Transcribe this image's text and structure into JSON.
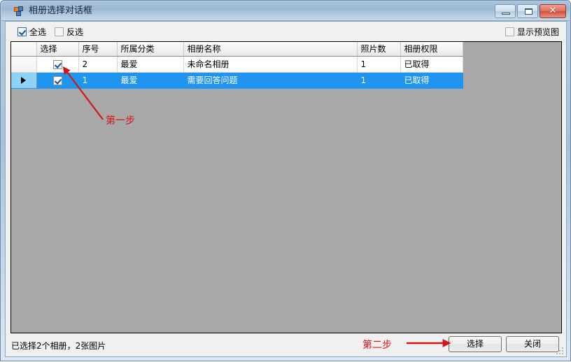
{
  "window": {
    "title": "相册选择对话框",
    "icon": "form-icon",
    "controls": {
      "minimize": "minimize-icon",
      "maximize": "maximize-icon",
      "close": "✕"
    }
  },
  "toolbar": {
    "select_all": {
      "label": "全选",
      "checked": true
    },
    "invert_selection": {
      "label": "反选",
      "checked": false
    },
    "show_preview": {
      "label": "显示预览图",
      "checked": false
    }
  },
  "grid": {
    "columns": [
      "选择",
      "序号",
      "所属分类",
      "相册名称",
      "照片数",
      "相册权限"
    ],
    "rows": [
      {
        "selected": false,
        "current": false,
        "checked": true,
        "index": "2",
        "category": "最爱",
        "name": "未命名相册",
        "photo_count": "1",
        "permission": "已取得"
      },
      {
        "selected": true,
        "current": true,
        "checked": true,
        "index": "1",
        "category": "最爱",
        "name": "需要回答问题",
        "photo_count": "1",
        "permission": "已取得"
      }
    ]
  },
  "status": {
    "text": "已选择2个相册，2张图片"
  },
  "footer": {
    "select_button": "选择",
    "close_button": "关闭"
  },
  "annotations": {
    "step1": "第一步",
    "step2": "第二步",
    "color": "#d41616"
  }
}
